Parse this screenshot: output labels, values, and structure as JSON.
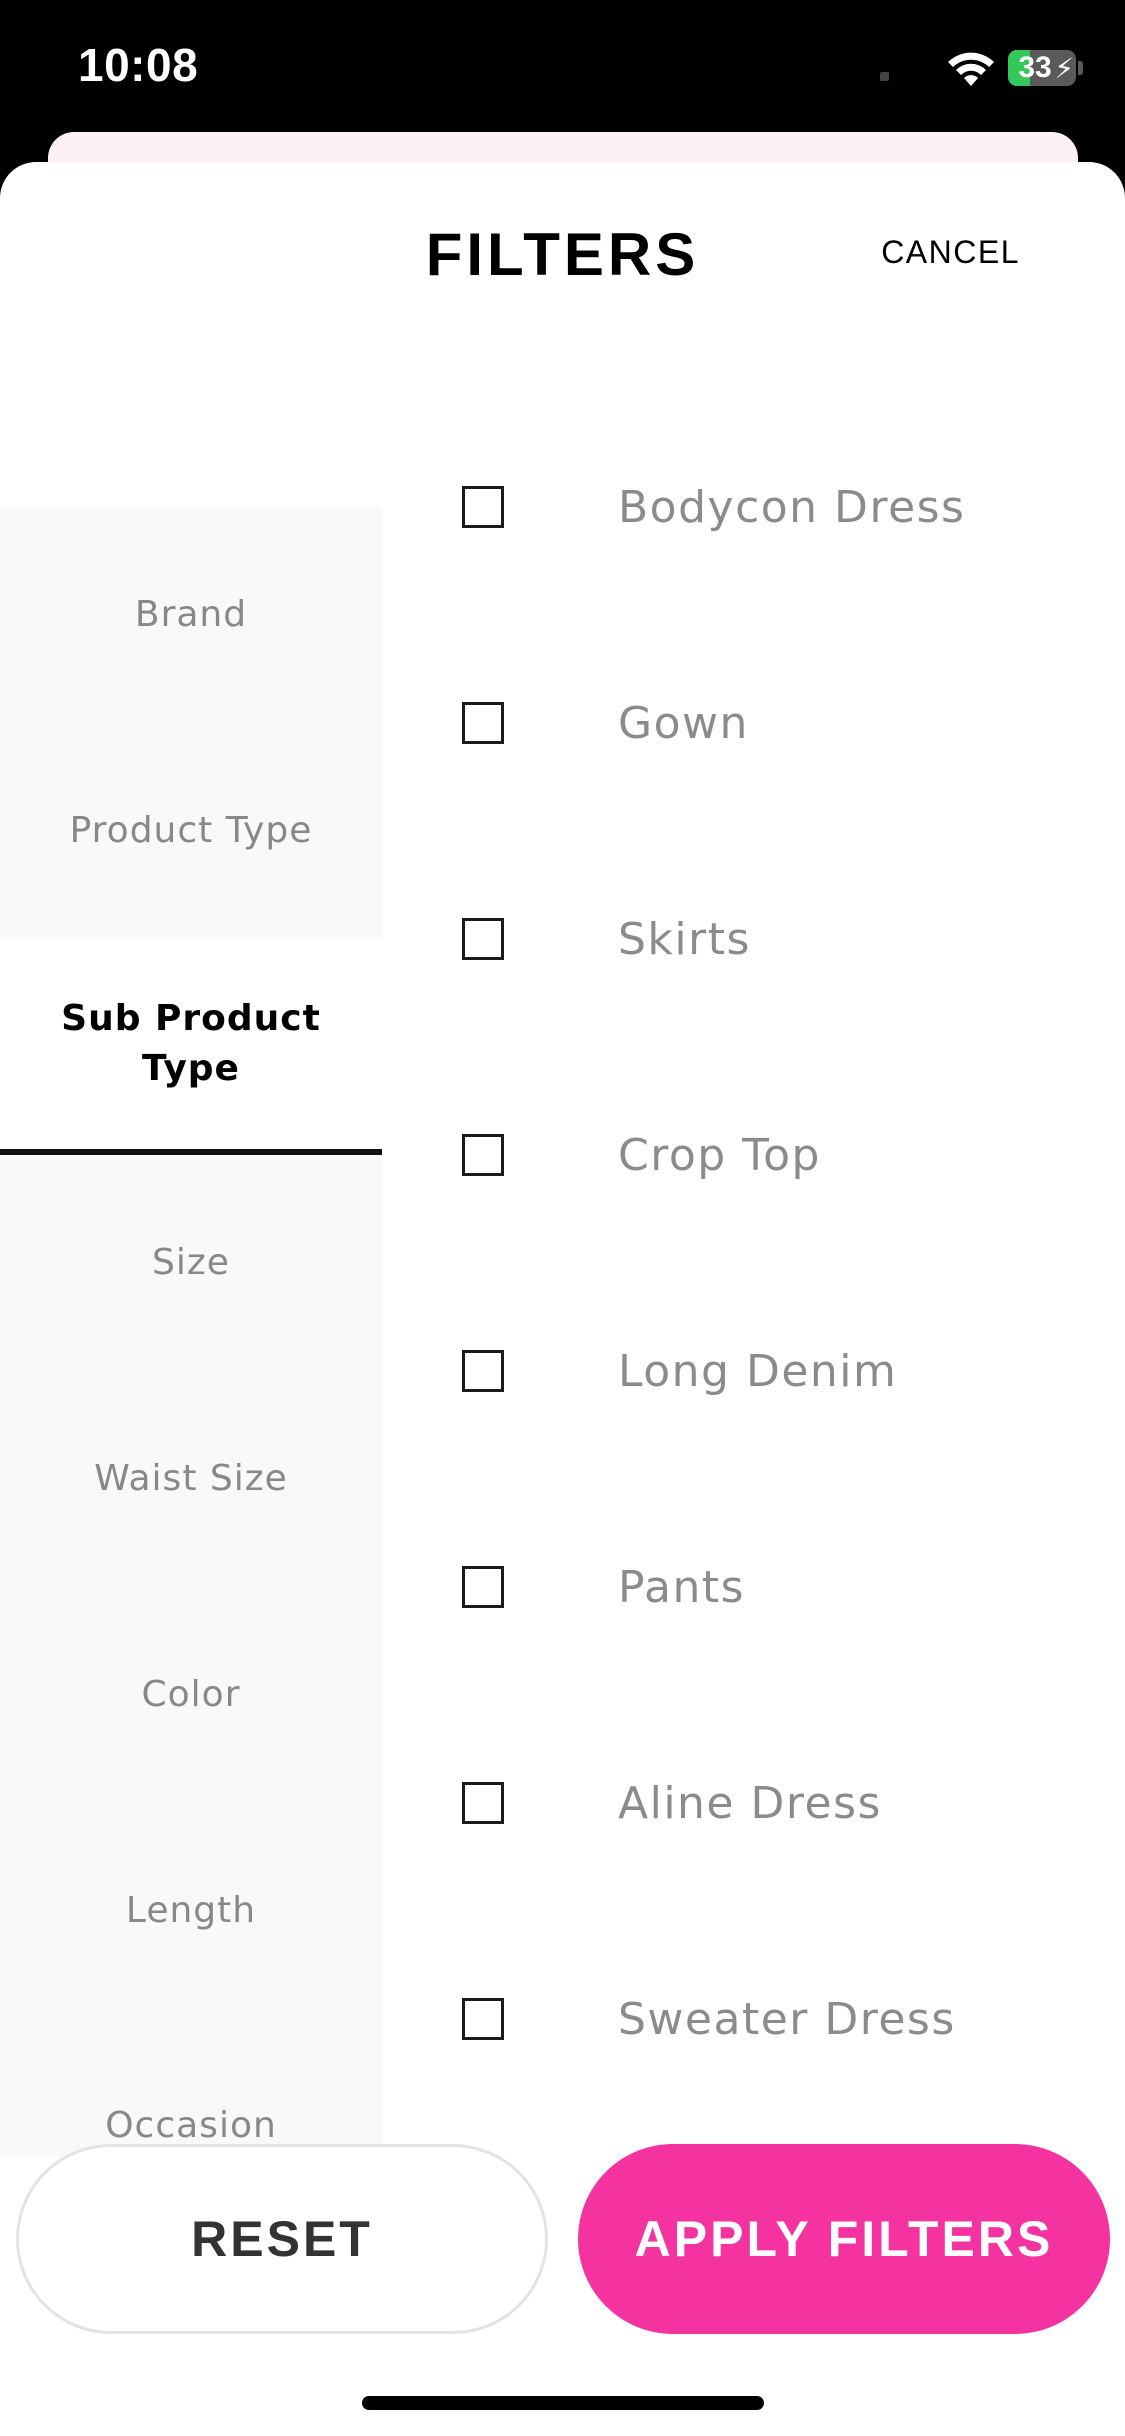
{
  "status_bar": {
    "time": "10:08",
    "battery_level": "33",
    "battery_percent": 33,
    "battery_charging_icon": "bolt-icon",
    "wifi_icon": "wifi-icon"
  },
  "header": {
    "title": "FILTERS",
    "cancel_label": "CANCEL"
  },
  "sidebar": {
    "items": [
      {
        "label": "Brand",
        "active": false
      },
      {
        "label": "Product Type",
        "active": false
      },
      {
        "label": "Sub Product Type",
        "active": true
      },
      {
        "label": "Size",
        "active": false
      },
      {
        "label": "Waist Size",
        "active": false
      },
      {
        "label": "Color",
        "active": false
      },
      {
        "label": "Length",
        "active": false
      },
      {
        "label": "Occasion",
        "active": false
      }
    ]
  },
  "options": [
    {
      "label": "Bodycon Dress",
      "checked": false
    },
    {
      "label": "Gown",
      "checked": false
    },
    {
      "label": "Skirts",
      "checked": false
    },
    {
      "label": "Crop Top",
      "checked": false
    },
    {
      "label": "Long Denim",
      "checked": false
    },
    {
      "label": "Pants",
      "checked": false
    },
    {
      "label": "Aline Dress",
      "checked": false
    },
    {
      "label": "Sweater Dress",
      "checked": false
    }
  ],
  "footer": {
    "reset_label": "RESET",
    "apply_label": "APPLY FILTERS"
  },
  "colors": {
    "accent": "#f433a0",
    "sidebar_bg": "#f9f9f9",
    "muted_text": "#8b8b8b"
  }
}
